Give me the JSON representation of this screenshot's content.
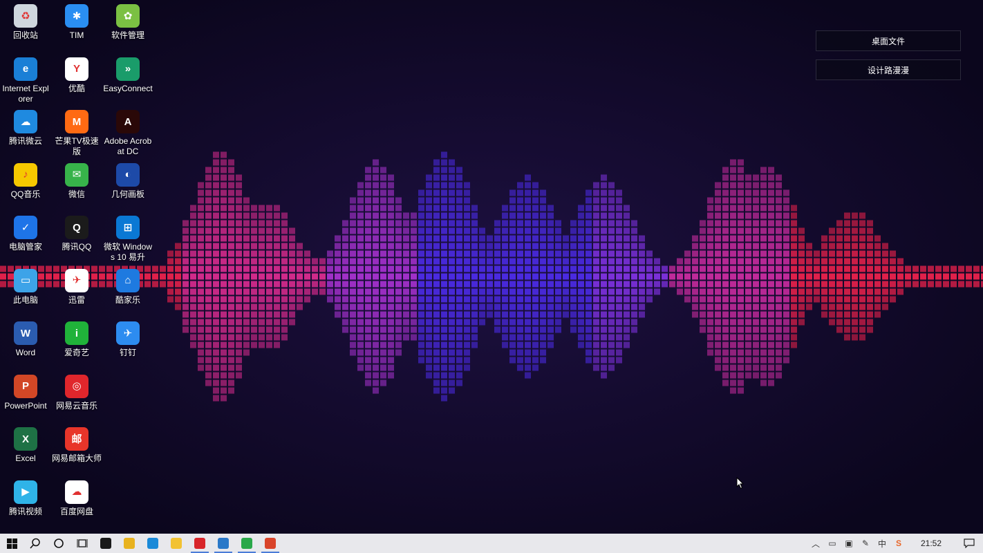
{
  "desktop": {
    "icons": [
      {
        "label": "回收站",
        "icon": "recycle-bin-icon",
        "color": "#cfd6de",
        "glyph": "♻"
      },
      {
        "label": "Internet Explorer",
        "icon": "internet-explorer-icon",
        "color": "#1a7fd6",
        "glyph": "e"
      },
      {
        "label": "腾讯微云",
        "icon": "tencent-weiyun-icon",
        "color": "#1f8ae0",
        "glyph": "☁"
      },
      {
        "label": "QQ音乐",
        "icon": "qq-music-icon",
        "color": "#f6c800",
        "glyph": "♪"
      },
      {
        "label": "电脑管家",
        "icon": "pc-manager-icon",
        "color": "#1e74e8",
        "glyph": "✓"
      },
      {
        "label": "此电脑",
        "icon": "this-pc-icon",
        "color": "#3da3e8",
        "glyph": "▭"
      },
      {
        "label": "Word",
        "icon": "word-icon",
        "color": "#2b5cb0",
        "glyph": "W"
      },
      {
        "label": "PowerPoint",
        "icon": "powerpoint-icon",
        "color": "#d24726",
        "glyph": "P"
      },
      {
        "label": "Excel",
        "icon": "excel-icon",
        "color": "#1e7145",
        "glyph": "X"
      },
      {
        "label": "腾讯视频",
        "icon": "tencent-video-icon",
        "color": "#2fb3e8",
        "glyph": "▶"
      },
      {
        "label": "TIM",
        "icon": "tim-icon",
        "color": "#2a8ef2",
        "glyph": "✱"
      },
      {
        "label": "优酷",
        "icon": "youku-icon",
        "color": "#ffffff",
        "glyph": "Y"
      },
      {
        "label": "芒果TV极速版",
        "icon": "mango-tv-icon",
        "color": "#ff6a13",
        "glyph": "M"
      },
      {
        "label": "微信",
        "icon": "wechat-icon",
        "color": "#37b34a",
        "glyph": "✉"
      },
      {
        "label": "腾讯QQ",
        "icon": "qq-icon",
        "color": "#1b1b1b",
        "glyph": "Q"
      },
      {
        "label": "迅雷",
        "icon": "xunlei-icon",
        "color": "#ffffff",
        "glyph": "✈"
      },
      {
        "label": "爱奇艺",
        "icon": "iqiyi-icon",
        "color": "#20b23a",
        "glyph": "i"
      },
      {
        "label": "网易云音乐",
        "icon": "netease-music-icon",
        "color": "#e0262c",
        "glyph": "◎"
      },
      {
        "label": "网易邮箱大师",
        "icon": "netease-mail-icon",
        "color": "#e8352a",
        "glyph": "邮"
      },
      {
        "label": "百度网盘",
        "icon": "baidu-netdisk-icon",
        "color": "#ffffff",
        "glyph": "☁"
      },
      {
        "label": "软件管理",
        "icon": "software-manager-icon",
        "color": "#7bc043",
        "glyph": "✿"
      },
      {
        "label": "EasyConnect",
        "icon": "easyconnect-icon",
        "color": "#1a9c6a",
        "glyph": "»"
      },
      {
        "label": "Adobe Acrobat DC",
        "icon": "adobe-acrobat-icon",
        "color": "#2a0808",
        "glyph": "A"
      },
      {
        "label": "几何画板",
        "icon": "sketchpad-icon",
        "color": "#1d4aa8",
        "glyph": "◐"
      },
      {
        "label": "微软 Windows 10 易升",
        "icon": "windows-upgrade-icon",
        "color": "#0a78d4",
        "glyph": "⊞"
      },
      {
        "label": "酷家乐",
        "icon": "kujiale-icon",
        "color": "#1e7ae0",
        "glyph": "⌂"
      },
      {
        "label": "钉钉",
        "icon": "dingtalk-icon",
        "color": "#2d8cf0",
        "glyph": "✈"
      }
    ]
  },
  "widgets": {
    "desktop_files": "桌面文件",
    "design_road": "设计路漫漫"
  },
  "taskbar": {
    "items": [
      {
        "icon": "windows-start-icon",
        "color": "#1a1a1a",
        "active": false
      },
      {
        "icon": "search-icon",
        "color": "#1a1a1a",
        "active": false
      },
      {
        "icon": "cortana-icon",
        "color": "#1a1a1a",
        "active": false
      },
      {
        "icon": "task-view-icon",
        "color": "#1a1a1a",
        "active": false
      },
      {
        "icon": "store-icon",
        "color": "#1a1a1a",
        "active": false
      },
      {
        "icon": "chrome-icon",
        "color": "#e8b21f",
        "active": false
      },
      {
        "icon": "edge-icon",
        "color": "#1b8ad8",
        "active": false
      },
      {
        "icon": "file-explorer-icon",
        "color": "#f2c232",
        "active": false
      },
      {
        "icon": "netease-music-taskbar-icon",
        "color": "#d8252a",
        "active": true
      },
      {
        "icon": "sandbox-app-icon",
        "color": "#2a78c8",
        "active": true
      },
      {
        "icon": "green-app-icon",
        "color": "#2aa84a",
        "active": true
      },
      {
        "icon": "red-app-icon",
        "color": "#d9442a",
        "active": true
      }
    ],
    "tray": [
      "chevron-up-icon",
      "battery-icon",
      "network-icon",
      "pen-icon",
      "input-method-icon",
      "sogou-icon"
    ],
    "clock": "21:52",
    "notification_icon": "notification-icon"
  }
}
